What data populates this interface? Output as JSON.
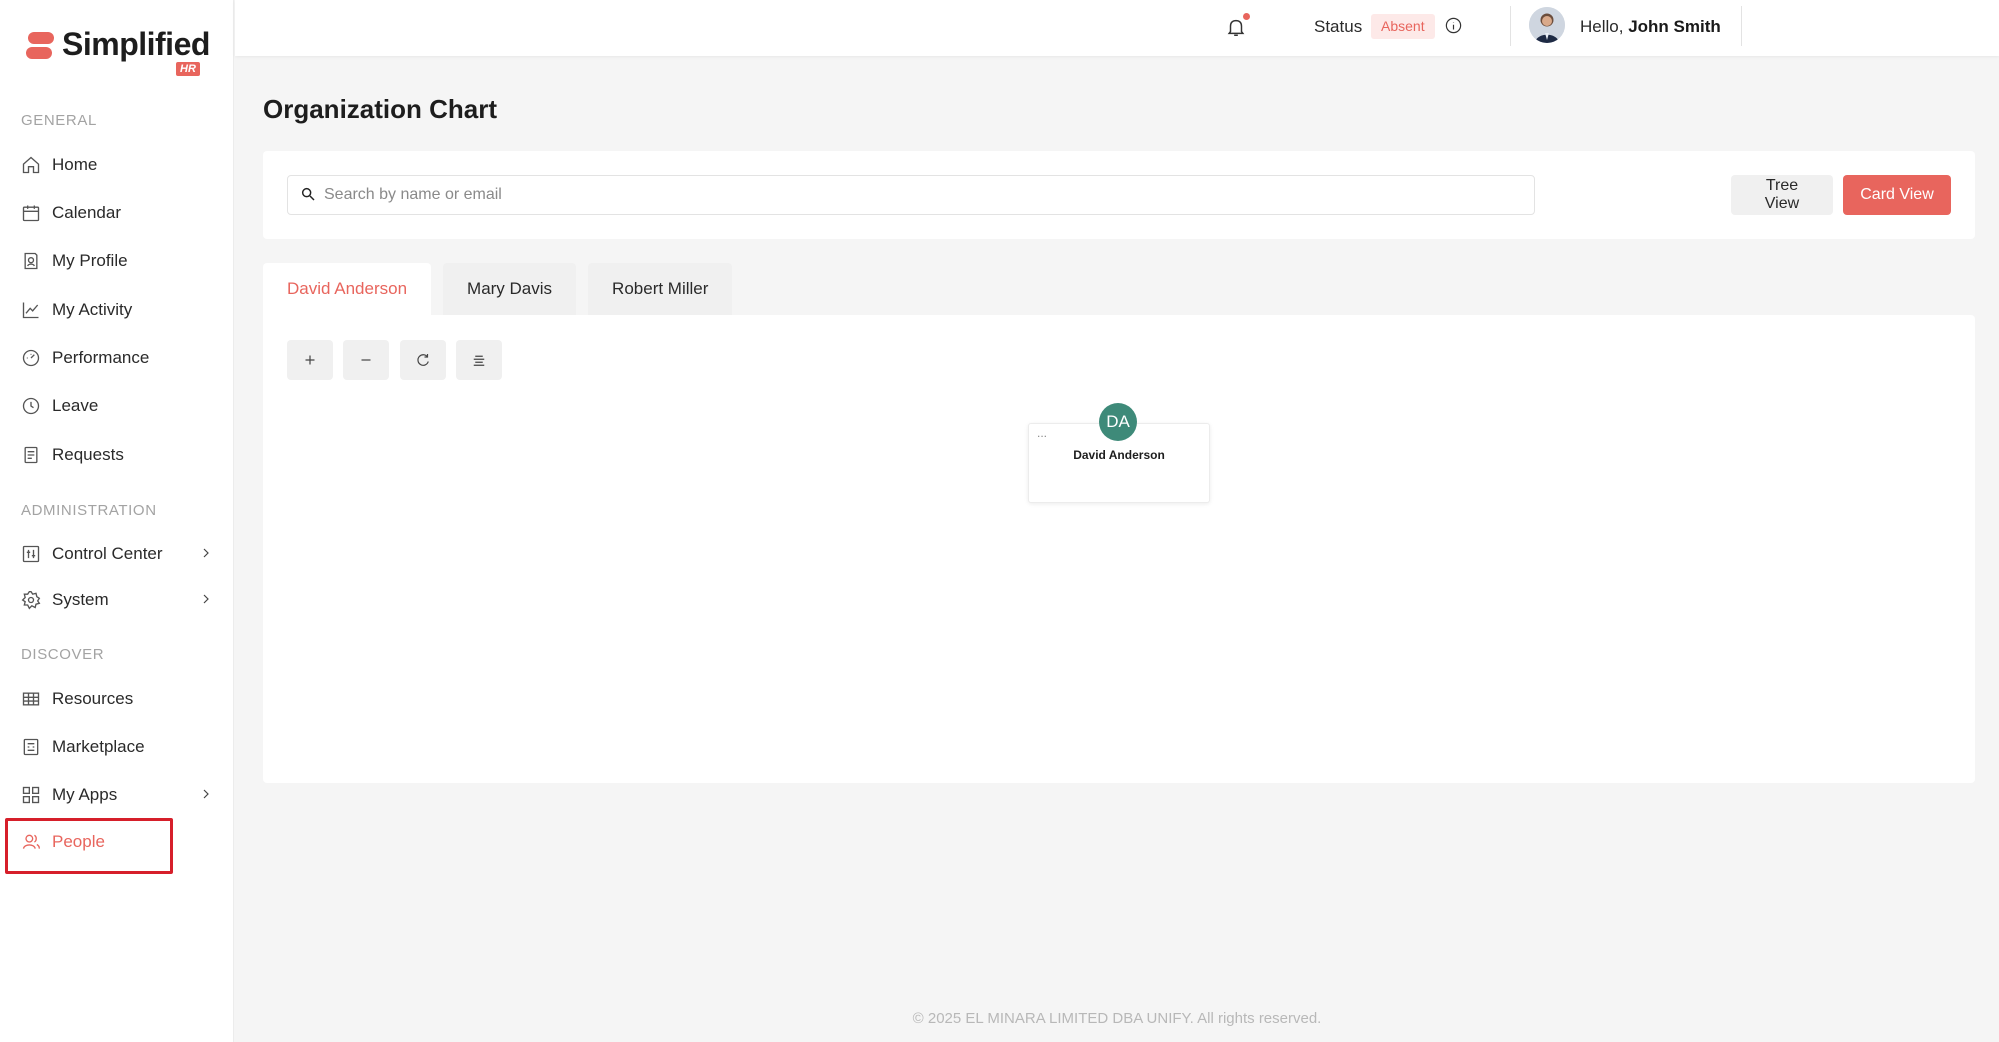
{
  "brand": {
    "name": "Simplified",
    "badge": "HR"
  },
  "sidebar": {
    "sections": [
      {
        "label": "GENERAL"
      },
      {
        "label": "ADMINISTRATION"
      },
      {
        "label": "DISCOVER"
      }
    ],
    "items": [
      {
        "label": "Home",
        "icon": "home-icon"
      },
      {
        "label": "Calendar",
        "icon": "calendar-icon"
      },
      {
        "label": "My Profile",
        "icon": "profile-icon"
      },
      {
        "label": "My Activity",
        "icon": "activity-chart-icon"
      },
      {
        "label": "Performance",
        "icon": "gauge-icon"
      },
      {
        "label": "Leave",
        "icon": "clock-icon"
      },
      {
        "label": "Requests",
        "icon": "document-icon"
      },
      {
        "label": "Control Center",
        "icon": "sliders-icon"
      },
      {
        "label": "System",
        "icon": "gear-icon"
      },
      {
        "label": "Resources",
        "icon": "table-icon"
      },
      {
        "label": "Marketplace",
        "icon": "store-icon"
      },
      {
        "label": "My Apps",
        "icon": "grid-icon"
      },
      {
        "label": "People",
        "icon": "people-icon",
        "active": true
      }
    ]
  },
  "topbar": {
    "status_label": "Status",
    "status_value": "Absent",
    "greeting": "Hello,",
    "user_name": "John Smith"
  },
  "main": {
    "title": "Organization Chart",
    "search": {
      "placeholder": "Search by name or email",
      "value": ""
    },
    "tree_view_label": "Tree View",
    "card_view_label": "Card View",
    "tabs": [
      {
        "label": "David Anderson",
        "active": true
      },
      {
        "label": "Mary Davis"
      },
      {
        "label": "Robert Miller"
      }
    ],
    "toolbar": [
      "zoom-in-icon",
      "zoom-out-icon",
      "reset-icon",
      "align-center-icon"
    ],
    "node": {
      "initials": "DA",
      "menu": "...",
      "name": "David Anderson"
    }
  },
  "footer": {
    "text": "© 2025 EL MINARA LIMITED DBA UNIFY. All rights reserved."
  },
  "colors": {
    "accent": "#e8655d",
    "avatar_bg": "#3e8a79",
    "highlight": "#d61f2a"
  }
}
